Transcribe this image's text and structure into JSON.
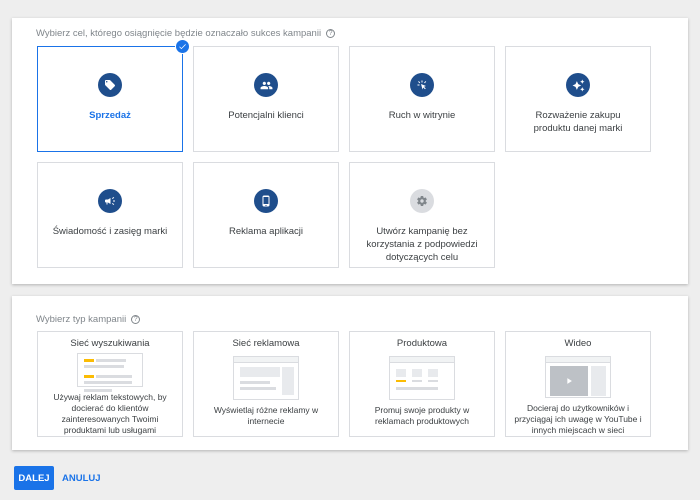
{
  "goal_section": {
    "label": "Wybierz cel, którego osiągnięcie będzie oznaczało sukces kampanii",
    "help_icon": "?",
    "cards": [
      {
        "label": "Sprzedaż",
        "icon": "tag-icon",
        "selected": true
      },
      {
        "label": "Potencjalni klienci",
        "icon": "people-icon",
        "selected": false
      },
      {
        "label": "Ruch w witrynie",
        "icon": "cursor-click-icon",
        "selected": false
      },
      {
        "label": "Rozważenie zakupu produktu danej marki",
        "icon": "sparkle-icon",
        "selected": false
      },
      {
        "label": "Świadomość i zasięg marki",
        "icon": "megaphone-icon",
        "selected": false
      },
      {
        "label": "Reklama aplikacji",
        "icon": "phone-icon",
        "selected": false
      },
      {
        "label": "Utwórz kampanię bez korzystania z podpowiedzi dotyczących celu",
        "icon": "gear-icon",
        "selected": false
      }
    ]
  },
  "type_section": {
    "label": "Wybierz typ kampanii",
    "help_icon": "?",
    "cards": [
      {
        "title": "Sieć wyszukiwania",
        "description": "Używaj reklam tekstowych, by docierać do klientów zainteresowanych Twoimi produktami lub usługami",
        "illustration": "search-ads-illustration"
      },
      {
        "title": "Sieć reklamowa",
        "description": "Wyświetlaj różne reklamy w internecie",
        "illustration": "display-ads-illustration"
      },
      {
        "title": "Produktowa",
        "description": "Promuj swoje produkty w reklamach produktowych",
        "illustration": "shopping-ads-illustration"
      },
      {
        "title": "Wideo",
        "description": "Docieraj do użytkowników i przyciągaj ich uwagę w YouTube i innych miejscach w sieci",
        "illustration": "video-ads-illustration"
      }
    ]
  },
  "actions": {
    "next_label": "DALEJ",
    "cancel_label": "ANULUJ"
  },
  "colors": {
    "accent": "#1a73e8",
    "icon_dark_blue": "#1f4e8c",
    "background": "#eeeeee"
  }
}
